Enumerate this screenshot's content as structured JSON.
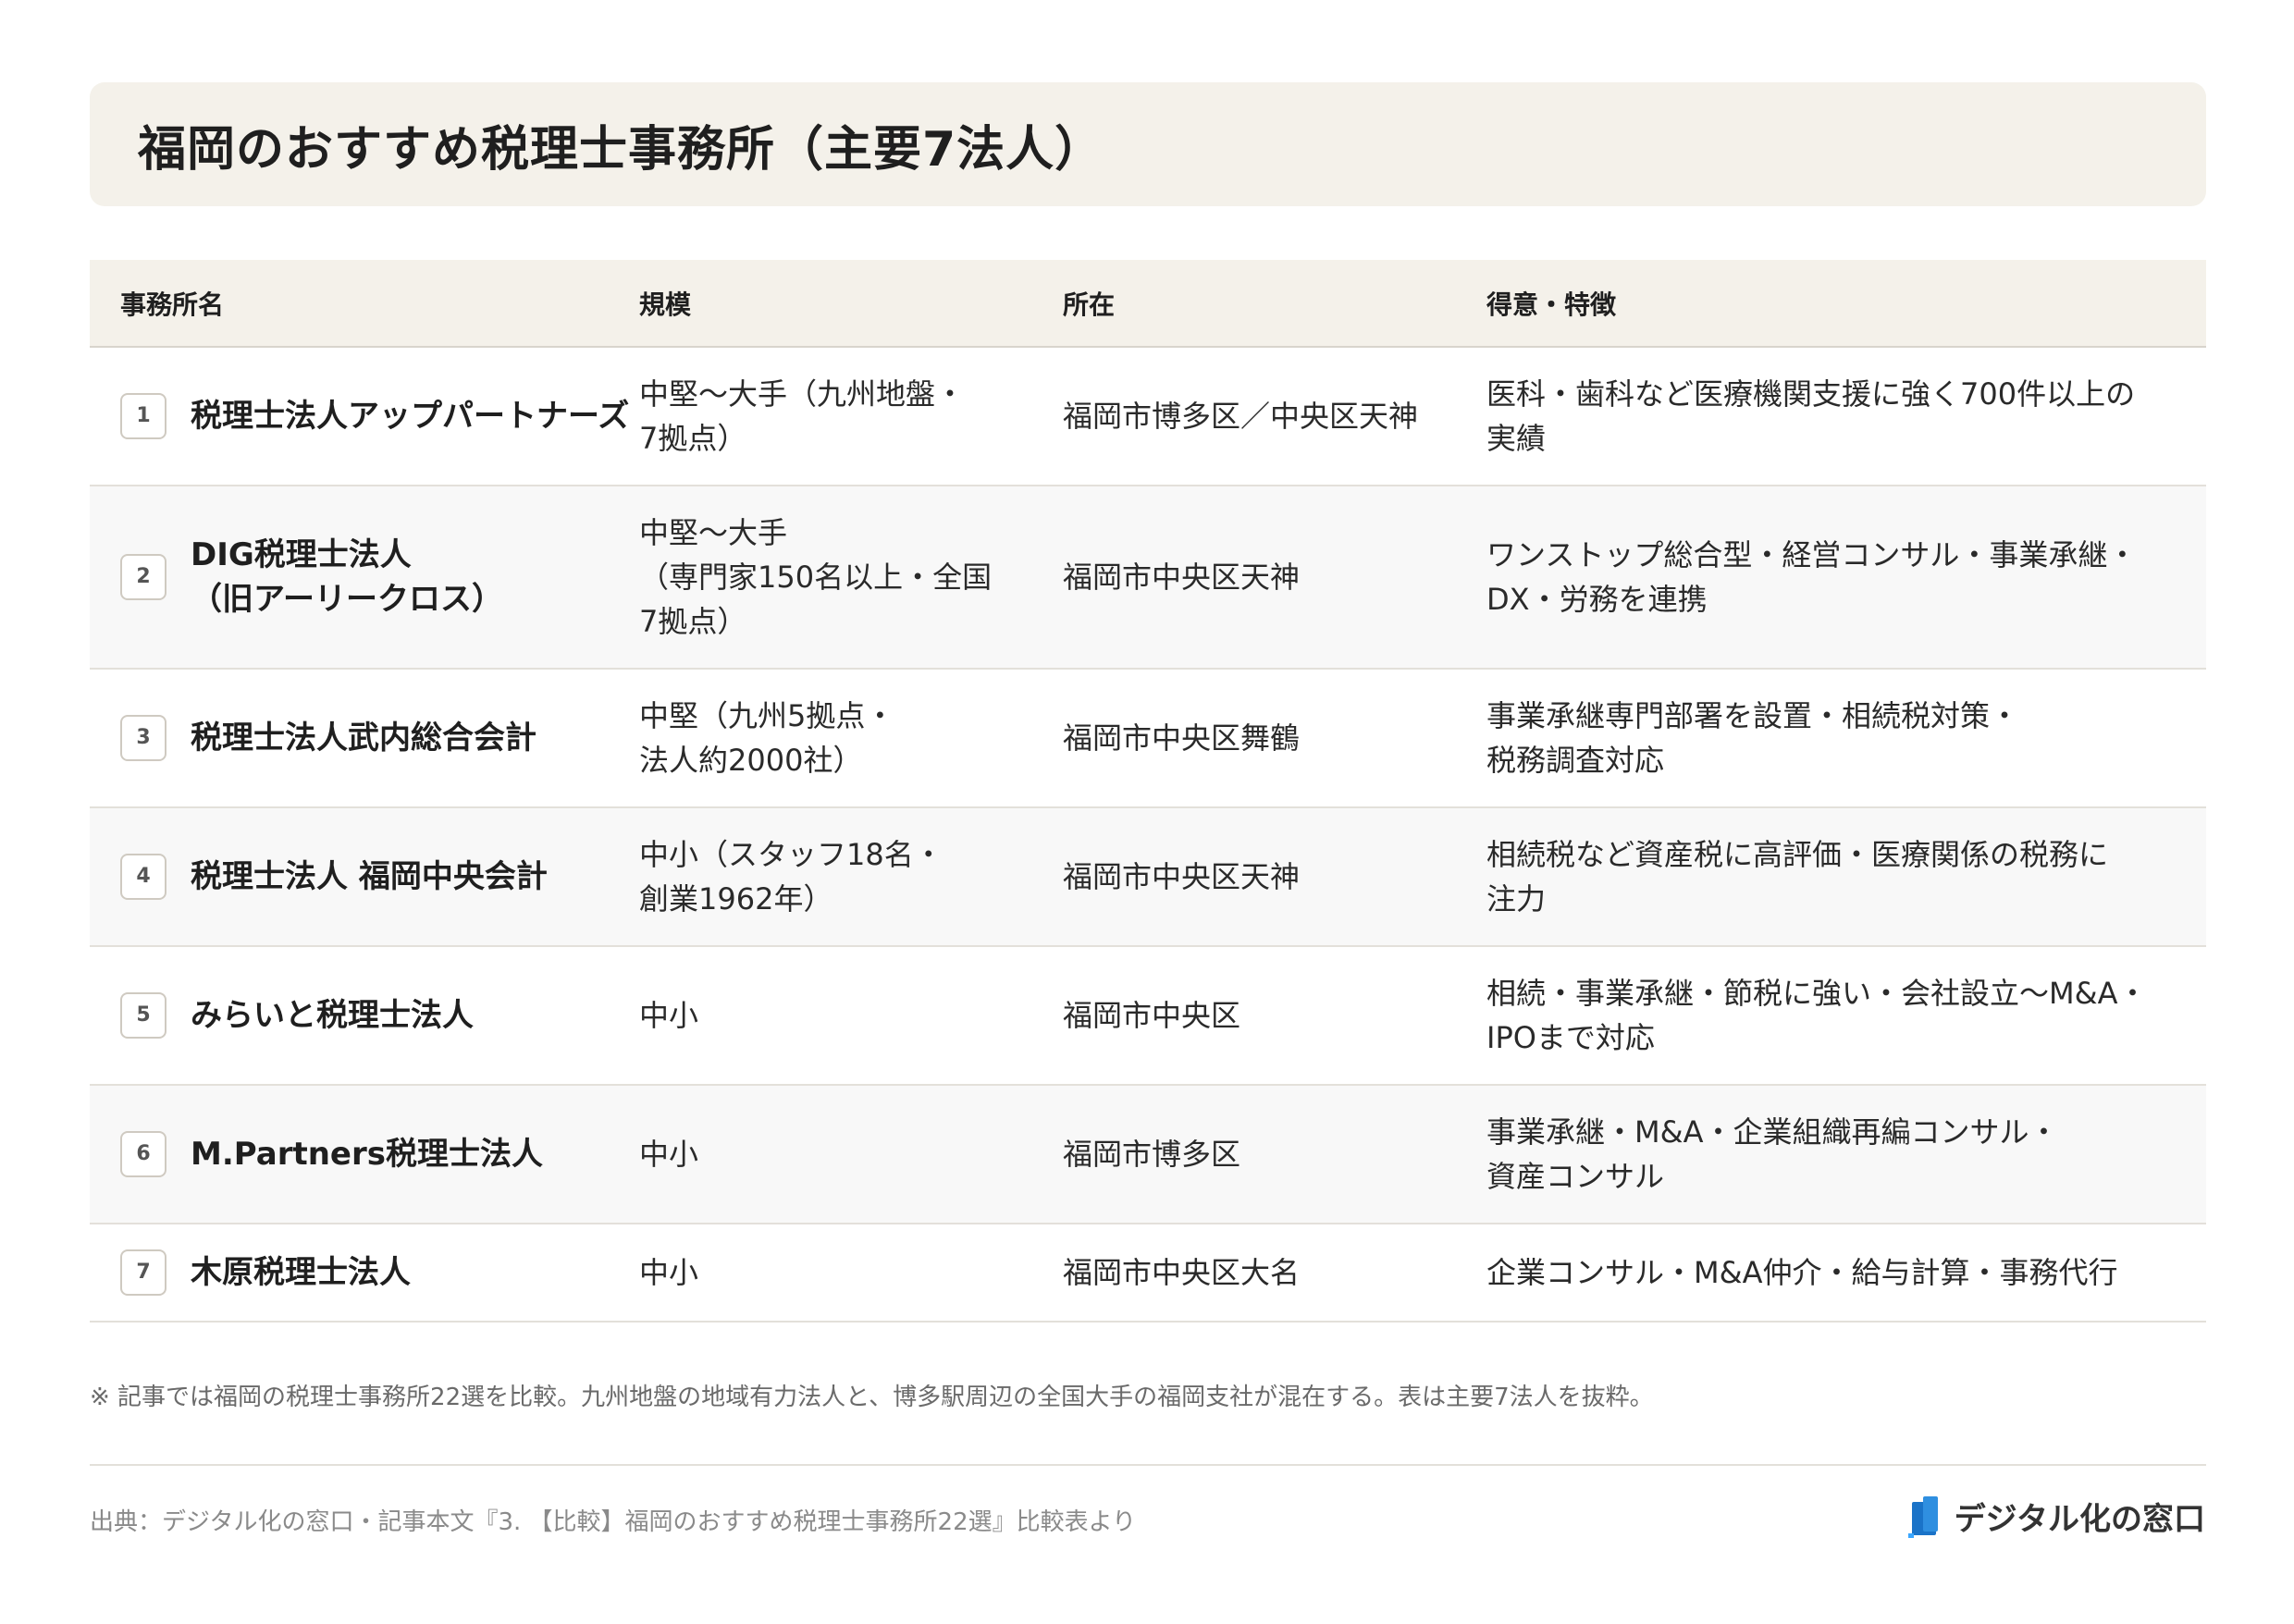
{
  "title": "福岡のおすすめ税理士事務所（主要7法人）",
  "table": {
    "headers": [
      "事務所名",
      "規模",
      "所在",
      "得意・特徴"
    ],
    "rows": [
      {
        "num": "1",
        "name": [
          "税理士法人アップパートナーズ"
        ],
        "scale": [
          "中堅〜大手（九州地盤・",
          "7拠点）"
        ],
        "location": "福岡市博多区／中央区天神",
        "feature": [
          "医科・歯科など医療機関支援に強く700件以上の",
          "実績"
        ]
      },
      {
        "num": "2",
        "name": [
          "DIG税理士法人",
          "（旧アーリークロス）"
        ],
        "scale": [
          "中堅〜大手",
          "（専門家150名以上・全国",
          "7拠点）"
        ],
        "location": "福岡市中央区天神",
        "feature": [
          "ワンストップ総合型・経営コンサル・事業承継・",
          "DX・労務を連携"
        ]
      },
      {
        "num": "3",
        "name": [
          "税理士法人武内総合会計"
        ],
        "scale": [
          "中堅（九州5拠点・",
          "法人約2000社）"
        ],
        "location": "福岡市中央区舞鶴",
        "feature": [
          "事業承継専門部署を設置・相続税対策・",
          "税務調査対応"
        ]
      },
      {
        "num": "4",
        "name": [
          "税理士法人 福岡中央会計"
        ],
        "scale": [
          "中小（スタッフ18名・",
          "創業1962年）"
        ],
        "location": "福岡市中央区天神",
        "feature": [
          "相続税など資産税に高評価・医療関係の税務に",
          "注力"
        ]
      },
      {
        "num": "5",
        "name": [
          "みらいと税理士法人"
        ],
        "scale": [
          "中小"
        ],
        "location": "福岡市中央区",
        "feature": [
          "相続・事業承継・節税に強い・会社設立〜M&A・",
          "IPOまで対応"
        ]
      },
      {
        "num": "6",
        "name": [
          "M.Partners税理士法人"
        ],
        "scale": [
          "中小"
        ],
        "location": "福岡市博多区",
        "feature": [
          "事業承継・M&A・企業組織再編コンサル・",
          "資産コンサル"
        ]
      },
      {
        "num": "7",
        "name": [
          "木原税理士法人"
        ],
        "scale": [
          "中小"
        ],
        "location": "福岡市中央区大名",
        "feature": [
          "企業コンサル・M&A仲介・給与計算・事務代行"
        ]
      }
    ]
  },
  "note": "※ 記事では福岡の税理士事務所22選を比較。九州地盤の地域有力法人と、博多駅周辺の全国大手の福岡支社が混在する。表は主要7法人を抜粋。",
  "source": "出典：デジタル化の窓口・記事本文『3. 【比較】福岡のおすすめ税理士事務所22選』比較表より",
  "brand": {
    "name": "デジタル化の窓口",
    "accent": "#1a73c8"
  }
}
